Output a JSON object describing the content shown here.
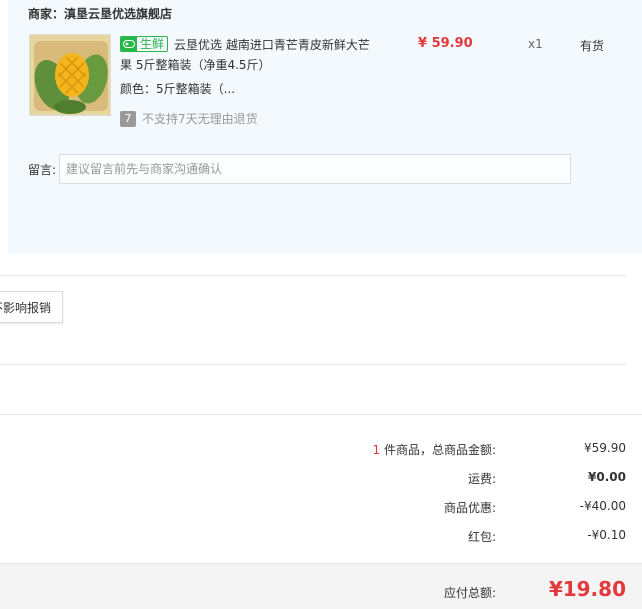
{
  "merchant": {
    "label": "商家：",
    "name": "滇垦云垦优选旗舰店"
  },
  "item": {
    "tag_label": "生鲜",
    "title": "云垦优选 越南进口青芒青皮新鲜大芒果 5斤整箱装（净重4.5斤）",
    "color_label": "颜色：",
    "color_value": "5斤整箱装（...",
    "return_icon_text": "7",
    "return_policy": "不支持7天无理由退货",
    "price": "¥ 59.90",
    "quantity": "x1",
    "stock": "有货"
  },
  "message": {
    "label": "留言:",
    "placeholder": "建议留言前先与商家沟通确认",
    "value": ""
  },
  "invoice": {
    "button_label": "不影响报销"
  },
  "summary": {
    "count": "1",
    "goods_label": " 件商品，总商品金额:",
    "goods_value": "¥59.90",
    "shipping_label": "运费:",
    "shipping_value": "¥0.00",
    "discount_label": "商品优惠:",
    "discount_value": "-¥40.00",
    "redpacket_label": "红包:",
    "redpacket_value": "-¥0.10"
  },
  "total": {
    "label": "应付总额:",
    "value": "¥19.80"
  },
  "colors": {
    "accent": "#e4393c",
    "fresh": "#28b54a",
    "panel_bg": "#f3f9fd"
  }
}
